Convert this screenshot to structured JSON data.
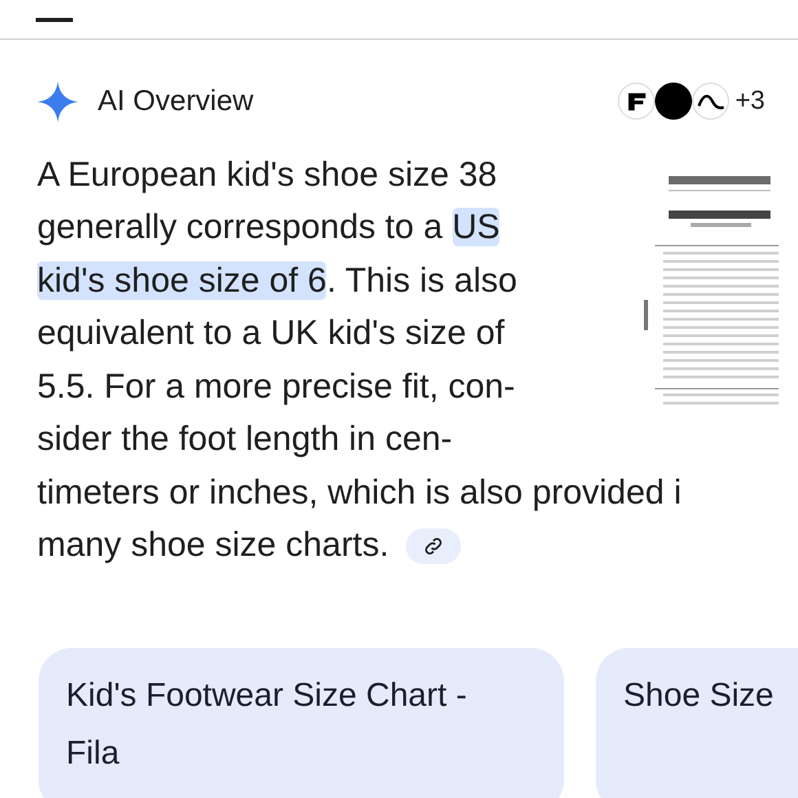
{
  "header": {
    "title": "AI Overview",
    "source_count": "+3"
  },
  "answer": {
    "lines": [
      [
        {
          "text": "A European kid's shoe size 38",
          "highlighted": false
        }
      ],
      [
        {
          "text": "generally corresponds to a ",
          "highlighted": false
        },
        {
          "text": "US",
          "highlighted": true
        }
      ],
      [
        {
          "text": "kid's shoe size of 6",
          "highlighted": true
        },
        {
          "text": ". This is also",
          "highlighted": false
        }
      ],
      [
        {
          "text": "equivalent to a UK kid's size of",
          "highlighted": false
        }
      ],
      [
        {
          "text": "5.5. For a more precise fit, con-",
          "highlighted": false
        }
      ],
      [
        {
          "text": "sider the foot length in cen-",
          "highlighted": false
        }
      ],
      [
        {
          "text": "timeters or inches, which is also provided i",
          "highlighted": false
        }
      ],
      [
        {
          "text": "many shoe size charts.",
          "highlighted": false
        }
      ]
    ]
  },
  "cards": [
    {
      "title": "Kid's Footwear Size Chart - Fila"
    },
    {
      "title": "Shoe Size"
    }
  ]
}
